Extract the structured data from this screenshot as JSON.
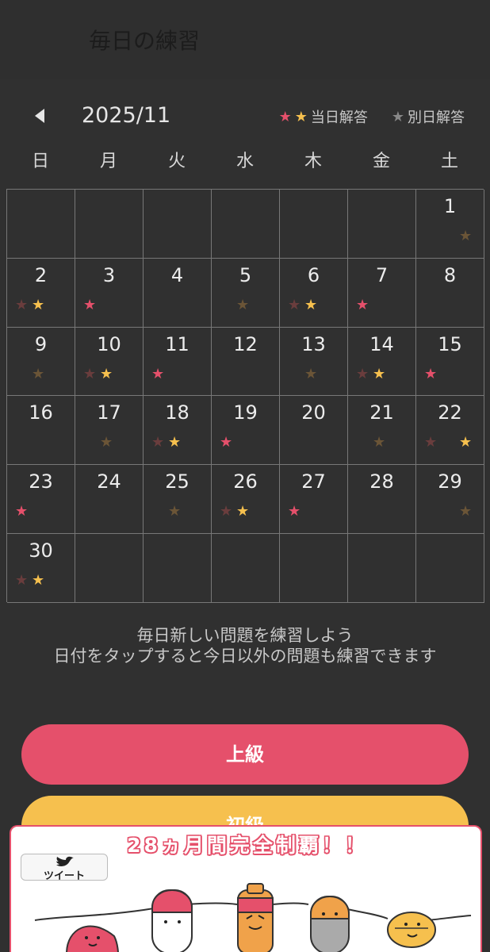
{
  "header": {
    "title": "毎日の練習"
  },
  "calendar": {
    "month_label": "2025/11",
    "legend": {
      "same_day_label": "当日解答",
      "other_day_label": "別日解答"
    },
    "weekdays": [
      "日",
      "月",
      "火",
      "水",
      "木",
      "金",
      "土"
    ],
    "star_colors": {
      "pink": "#e5506b",
      "yellow": "#f6c04e",
      "dim_red": "#6a3d3d",
      "dim_brown": "#6b5537"
    },
    "weeks": [
      [
        {
          "day": "",
          "stars": []
        },
        {
          "day": "",
          "stars": []
        },
        {
          "day": "",
          "stars": []
        },
        {
          "day": "",
          "stars": []
        },
        {
          "day": "",
          "stars": []
        },
        {
          "day": "",
          "stars": []
        },
        {
          "day": "1",
          "stars": [
            "right:brown"
          ]
        }
      ],
      [
        {
          "day": "2",
          "stars": [
            "left:dim",
            "mid:yellow"
          ]
        },
        {
          "day": "3",
          "stars": [
            "left:pink"
          ]
        },
        {
          "day": "4",
          "stars": []
        },
        {
          "day": "5",
          "stars": [
            "mid:brown"
          ]
        },
        {
          "day": "6",
          "stars": [
            "left:dim",
            "mid:yellow"
          ]
        },
        {
          "day": "7",
          "stars": [
            "left:pink"
          ]
        },
        {
          "day": "8",
          "stars": []
        }
      ],
      [
        {
          "day": "9",
          "stars": [
            "mid:brown"
          ]
        },
        {
          "day": "10",
          "stars": [
            "left:dim",
            "mid:yellow"
          ]
        },
        {
          "day": "11",
          "stars": [
            "left:pink"
          ]
        },
        {
          "day": "12",
          "stars": []
        },
        {
          "day": "13",
          "stars": [
            "mid:brown"
          ]
        },
        {
          "day": "14",
          "stars": [
            "left:dim",
            "mid:yellow"
          ]
        },
        {
          "day": "15",
          "stars": [
            "left:pink"
          ]
        }
      ],
      [
        {
          "day": "16",
          "stars": []
        },
        {
          "day": "17",
          "stars": [
            "mid:brown"
          ]
        },
        {
          "day": "18",
          "stars": [
            "left:dim",
            "mid:yellow"
          ]
        },
        {
          "day": "19",
          "stars": [
            "left:pink"
          ]
        },
        {
          "day": "20",
          "stars": []
        },
        {
          "day": "21",
          "stars": [
            "mid:brown"
          ]
        },
        {
          "day": "22",
          "stars": [
            "left:dim",
            "right:yellow"
          ]
        }
      ],
      [
        {
          "day": "23",
          "stars": [
            "left:pink"
          ]
        },
        {
          "day": "24",
          "stars": []
        },
        {
          "day": "25",
          "stars": [
            "mid:brown"
          ]
        },
        {
          "day": "26",
          "stars": [
            "left:dim",
            "mid:yellow"
          ]
        },
        {
          "day": "27",
          "stars": [
            "left:pink"
          ]
        },
        {
          "day": "28",
          "stars": []
        },
        {
          "day": "29",
          "stars": [
            "right:brown"
          ]
        }
      ],
      [
        {
          "day": "30",
          "stars": [
            "left:dim",
            "mid:yellow"
          ]
        },
        {
          "day": "",
          "stars": []
        },
        {
          "day": "",
          "stars": []
        },
        {
          "day": "",
          "stars": []
        },
        {
          "day": "",
          "stars": []
        },
        {
          "day": "",
          "stars": []
        },
        {
          "day": "",
          "stars": []
        }
      ]
    ]
  },
  "info": {
    "line1": "毎日新しい問題を練習しよう",
    "line2": "日付をタップすると今日以外の問題も練習できます"
  },
  "buttons": {
    "advanced": "上級",
    "beginner": "初級"
  },
  "ad": {
    "headline": "28ヵ月間完全制覇！！",
    "tweet_label": "ツイート"
  }
}
